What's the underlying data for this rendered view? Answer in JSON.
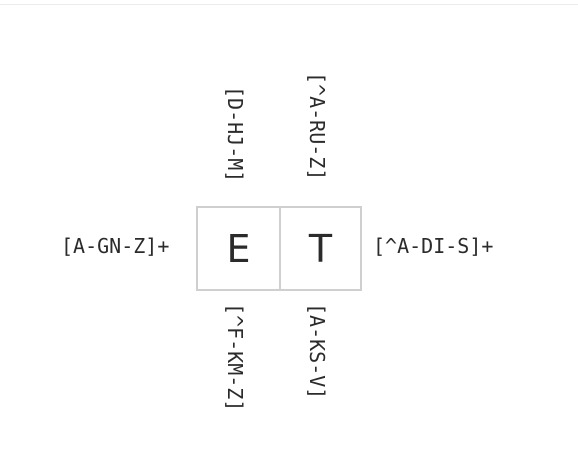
{
  "puzzle": {
    "grid": {
      "cells": [
        "E",
        "T"
      ]
    },
    "row_clues": {
      "left": "[A-GN-Z]+",
      "right": "[^A-DI-S]+"
    },
    "column_clues": [
      {
        "top": "[D-HJ-M]",
        "bottom": "[^F-KM-Z]"
      },
      {
        "top": "[^A-RU-Z]",
        "bottom": "[A-KS-V]"
      }
    ]
  }
}
